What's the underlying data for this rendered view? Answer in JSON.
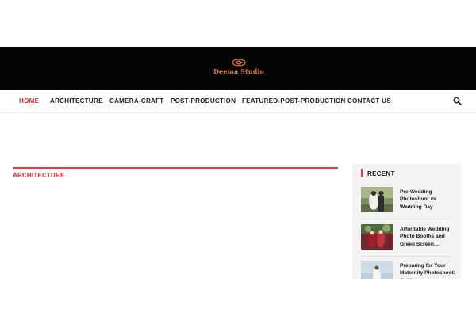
{
  "brand": {
    "name": "Deema Studio",
    "color": "#e0792b"
  },
  "nav": {
    "items": [
      {
        "label": "HOME",
        "active": true
      },
      {
        "label": "ARCHITECTURE"
      },
      {
        "label": "CAMERA-CRAFT"
      },
      {
        "label": "POST-PRODUCTION"
      },
      {
        "label": "FEATURED-POST-PRODUCTION"
      },
      {
        "label": "CONTACT US"
      }
    ],
    "search_icon": "search-icon",
    "accent_color": "#d7282f"
  },
  "main": {
    "category_title": "ARCHITECTURE"
  },
  "sidebar": {
    "widget_title": "RECENT",
    "posts": [
      {
        "title": "Pre-Wedding Photoshoot vs Wedding Day…"
      },
      {
        "title": "Affordable Wedding Photo Booths and Green Screen…"
      },
      {
        "title": "Preparing for Your Maternity Photoshoot: Guide…"
      }
    ]
  }
}
